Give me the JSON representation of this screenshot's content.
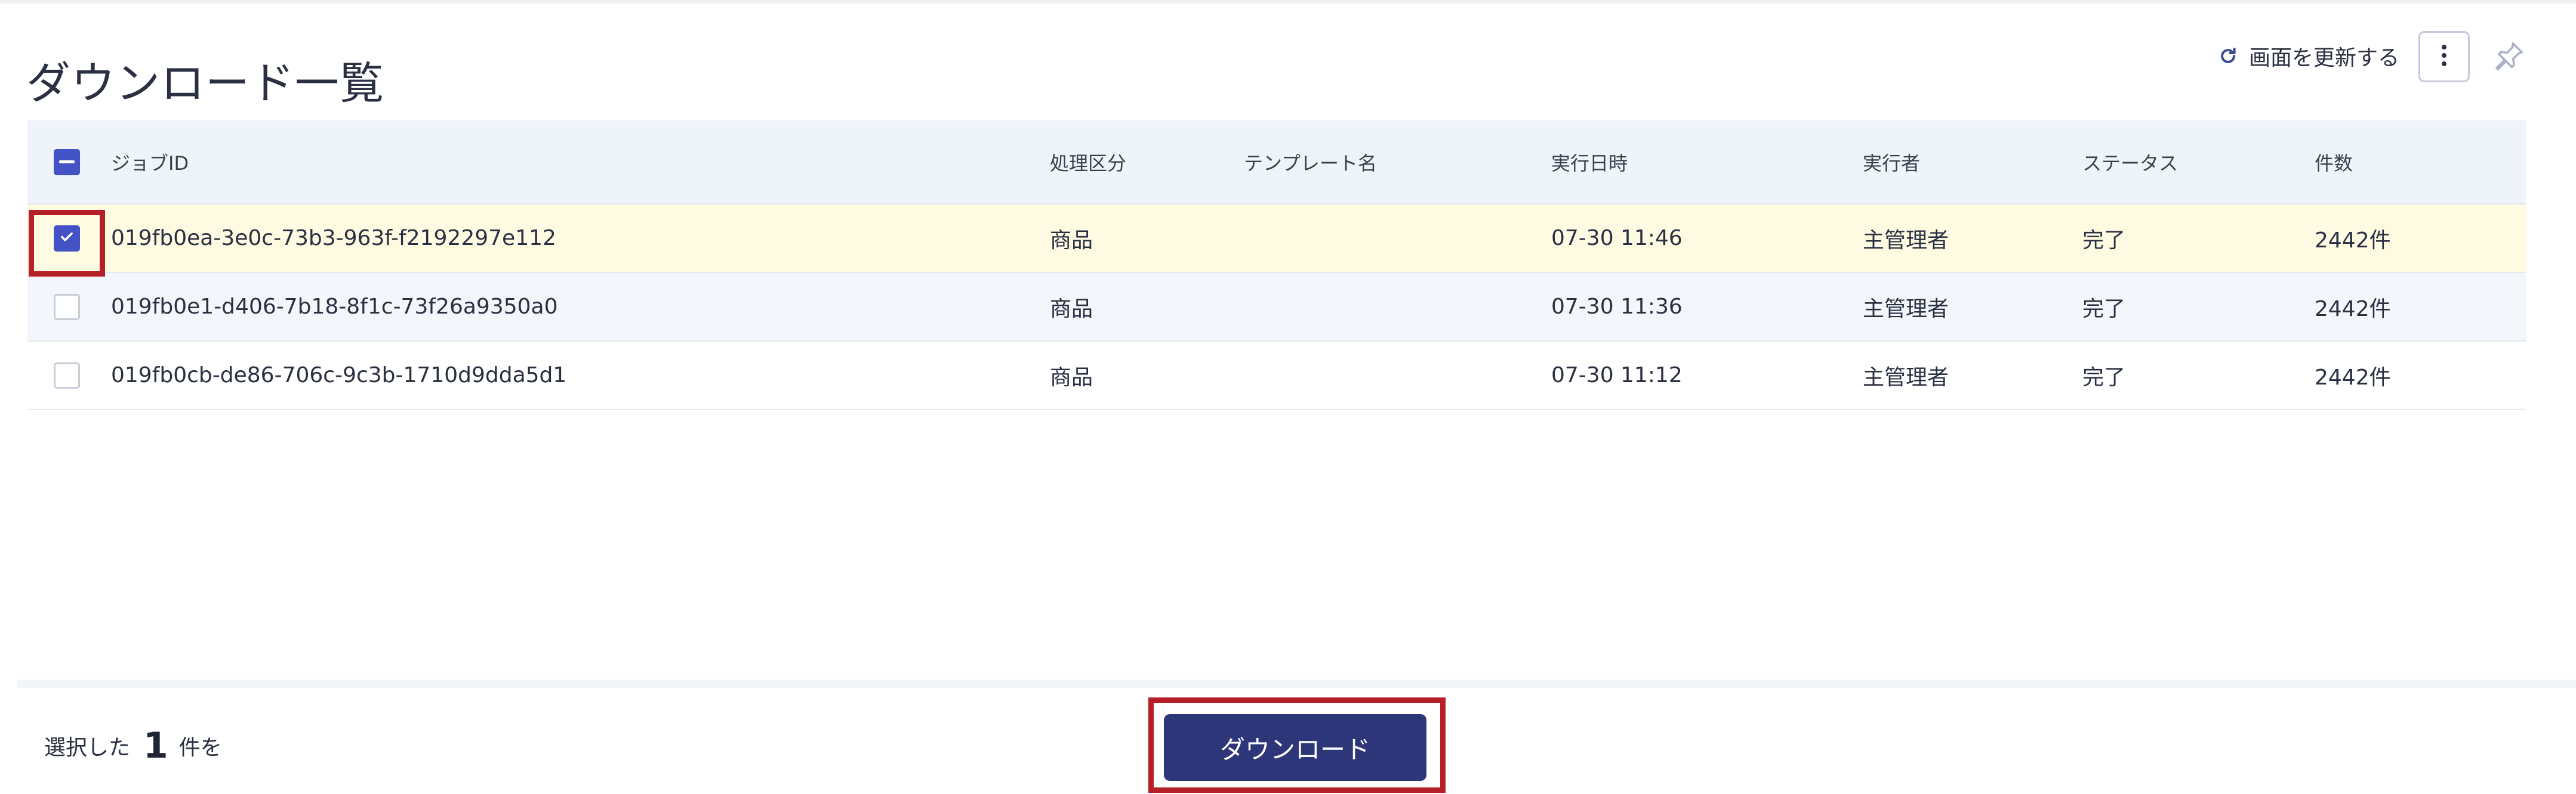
{
  "page": {
    "title": "ダウンロード一覧",
    "refresh_label": "画面を更新する"
  },
  "table": {
    "headers": {
      "job_id": "ジョブID",
      "category": "処理区分",
      "template": "テンプレート名",
      "executed_at": "実行日時",
      "executor": "実行者",
      "status": "ステータス",
      "count": "件数"
    },
    "rows": [
      {
        "job_id": "019fb0ea-3e0c-73b3-963f-f2192297e112",
        "category": "商品",
        "template": "",
        "executed_at": "07-30 11:46",
        "executor": "主管理者",
        "status": "完了",
        "count": "2442件",
        "checked": true
      },
      {
        "job_id": "019fb0e1-d406-7b18-8f1c-73f26a9350a0",
        "category": "商品",
        "template": "",
        "executed_at": "07-30 11:36",
        "executor": "主管理者",
        "status": "完了",
        "count": "2442件",
        "checked": false
      },
      {
        "job_id": "019fb0cb-de86-706c-9c3b-1710d9dda5d1",
        "category": "商品",
        "template": "",
        "executed_at": "07-30 11:12",
        "executor": "主管理者",
        "status": "完了",
        "count": "2442件",
        "checked": false
      }
    ]
  },
  "footer": {
    "selected_prefix": "選択した",
    "selected_count": "1",
    "selected_suffix": "件を",
    "download_label": "ダウンロード"
  },
  "colors": {
    "primary": "#2d3679",
    "checkbox": "#4352c4",
    "status_done": "#2f9b4b",
    "highlight": "#b51f27",
    "selected_row": "#fffbe3"
  },
  "icons": {
    "refresh": "refresh-icon",
    "more": "more-vertical-icon",
    "pin": "pin-icon",
    "check": "check-icon"
  }
}
